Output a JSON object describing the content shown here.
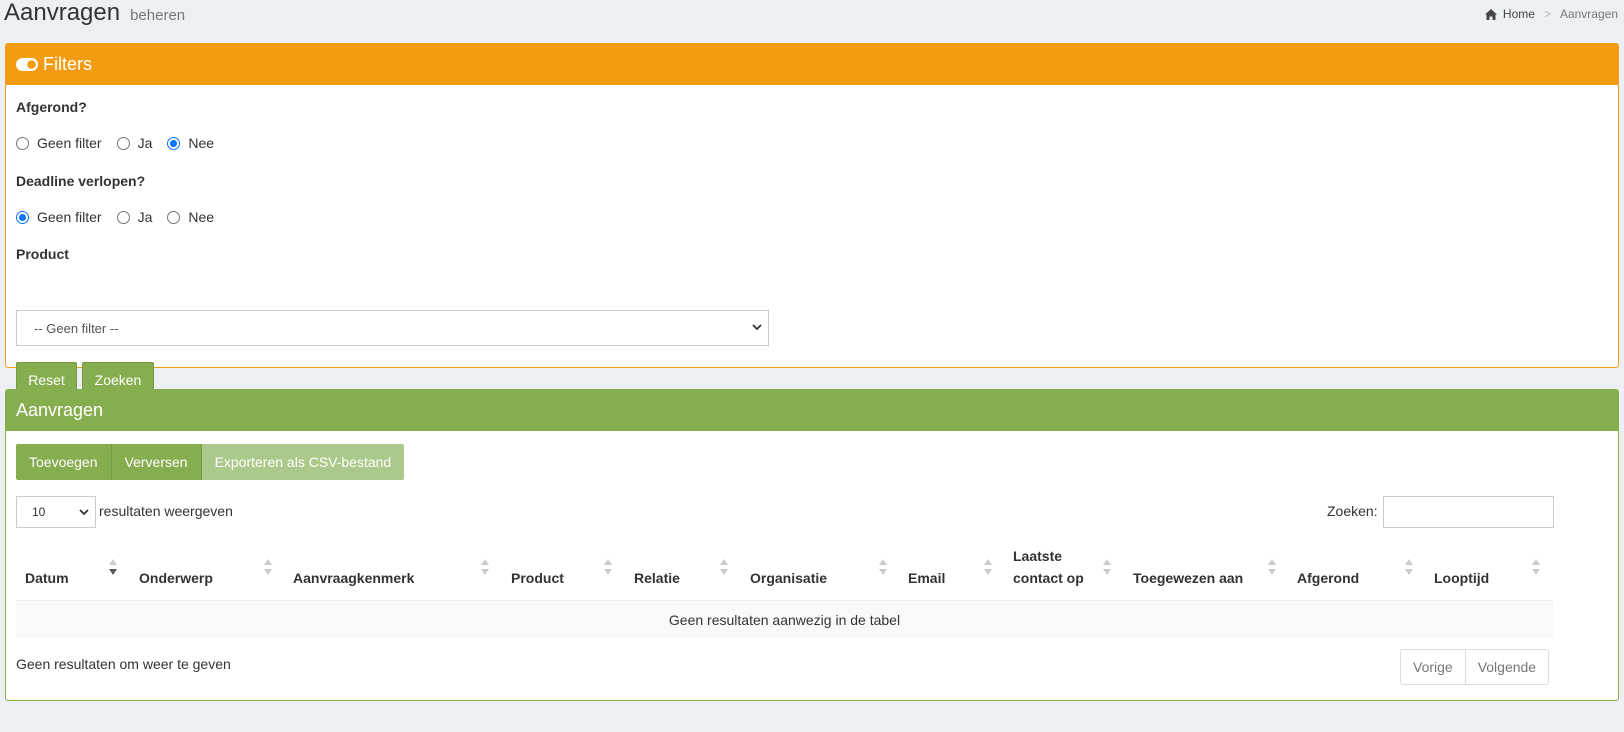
{
  "header": {
    "title": "Aanvragen",
    "subtitle": "beheren",
    "breadcrumb": {
      "home": "Home",
      "current": "Aanvragen"
    }
  },
  "filters": {
    "title": "Filters",
    "afgerond": {
      "label": "Afgerond?",
      "options": [
        "Geen filter",
        "Ja",
        "Nee"
      ],
      "selected": "Nee"
    },
    "deadline": {
      "label": "Deadline verlopen?",
      "options": [
        "Geen filter",
        "Ja",
        "Nee"
      ],
      "selected": "Geen filter"
    },
    "product": {
      "label": "Product",
      "selected": "-- Geen filter --"
    },
    "reset_label": "Reset",
    "search_label": "Zoeken"
  },
  "requests": {
    "title": "Aanvragen",
    "buttons": {
      "add": "Toevoegen",
      "refresh": "Verversen",
      "export": "Exporteren als CSV-bestand"
    },
    "page_length": "10",
    "page_length_label": "resultaten weergeven",
    "search_label": "Zoeken:",
    "search_value": "",
    "columns": [
      "Datum",
      "Onderwerp",
      "Aanvraagkenmerk",
      "Product",
      "Relatie",
      "Organisatie",
      "Email",
      "Laatste contact op",
      "Toegewezen aan",
      "Afgerond",
      "Looptijd"
    ],
    "empty_message": "Geen resultaten aanwezig in de tabel",
    "info": "Geen resultaten om weer te geven",
    "pager": {
      "prev": "Vorige",
      "next": "Volgende"
    }
  },
  "colors": {
    "filters_header": "#f39c12",
    "requests_header": "#86ad4e",
    "button_green": "#86ad4e",
    "background": "#ecf0f5"
  }
}
